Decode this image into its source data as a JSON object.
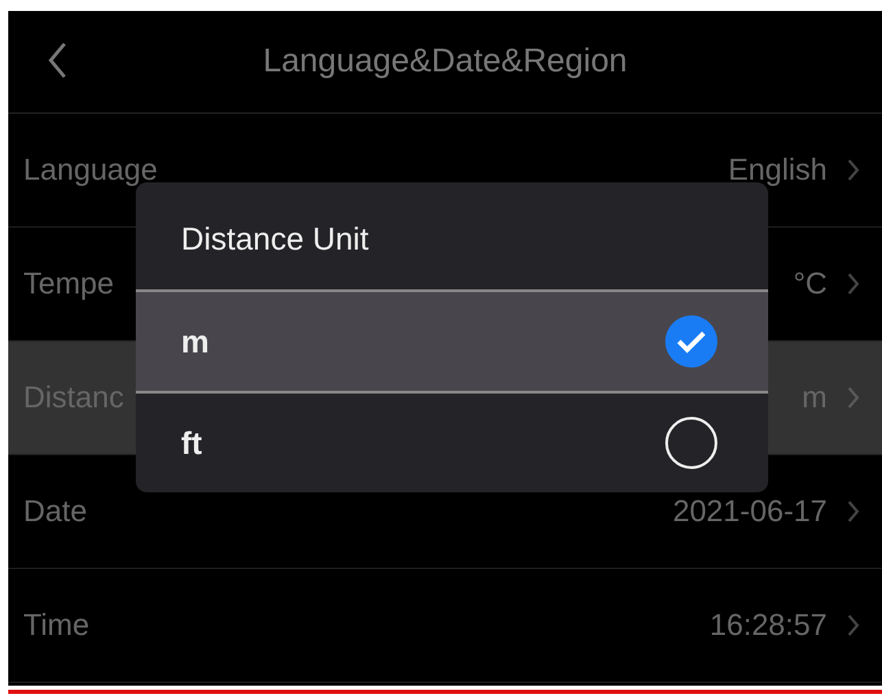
{
  "header": {
    "title": "Language&Date&Region"
  },
  "rows": [
    {
      "label": "Language",
      "value": "English",
      "selected": false
    },
    {
      "label": "Tempe",
      "value": "°C",
      "selected": false
    },
    {
      "label": "Distanc",
      "value": "m",
      "selected": true
    },
    {
      "label": "Date",
      "value": "2021-06-17",
      "selected": false
    },
    {
      "label": "Time",
      "value": "16:28:57",
      "selected": false
    }
  ],
  "dialog": {
    "title": "Distance Unit",
    "options": [
      {
        "label": "m",
        "selected": true
      },
      {
        "label": "ft",
        "selected": false
      }
    ]
  }
}
